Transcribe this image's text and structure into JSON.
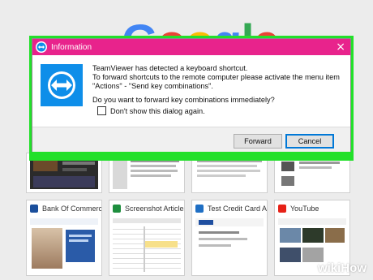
{
  "background": {
    "logo_text": "Google",
    "tiles": [
      {
        "title": "Bank Of Commerce B",
        "favicon_color": "#1b4f9c"
      },
      {
        "title": "Screenshot Articles M",
        "favicon_color": "#1e8e3e"
      },
      {
        "title": "Test Credit Card Acco",
        "favicon_color": "#1f6fc4"
      },
      {
        "title": "YouTube",
        "favicon_color": "#e62117"
      }
    ]
  },
  "dialog": {
    "title": "Information",
    "close_glyph": "×",
    "message_line1": "TeamViewer has detected a keyboard shortcut.",
    "message_line2": "To forward shortcuts to the remote computer please activate the menu item",
    "message_line3": "\"Actions\" - \"Send key combinations\".",
    "question": "Do you want to forward key combinations immediately?",
    "checkbox_label": "Don't show this dialog again.",
    "checkbox_checked": false,
    "forward_label": "Forward",
    "cancel_label": "Cancel",
    "title_bar_color": "#e8238c",
    "highlight_color": "#22e02a",
    "icon": "teamviewer-icon"
  },
  "watermark": {
    "wiki": "wiki",
    "how": "How"
  }
}
